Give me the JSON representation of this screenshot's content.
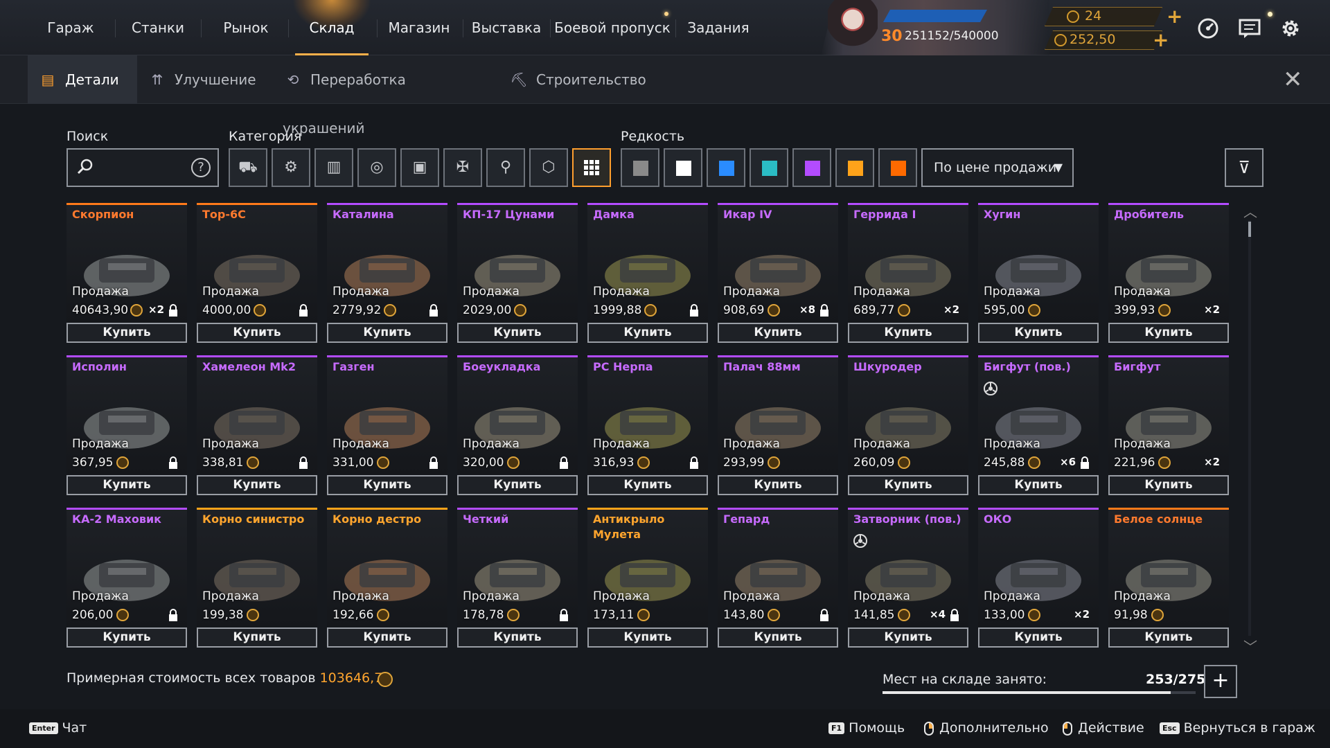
{
  "nav": {
    "items": [
      "Гараж",
      "Станки",
      "Рынок",
      "Склад",
      "Магазин",
      "Выставка",
      "Боевой пропуск",
      "Задания"
    ],
    "active": "Склад"
  },
  "profile": {
    "level": "30",
    "xp": "251152/540000",
    "currency_1": "24",
    "currency_2": "252,50",
    "xp_progress": 0.465
  },
  "subtabs": {
    "items": [
      {
        "label": "Детали",
        "icon": "parts-icon"
      },
      {
        "label": "Улучшение",
        "icon": "upgrade-icon"
      },
      {
        "label": "Переработка украшений",
        "icon": "recycle-icon"
      },
      {
        "label": "Строительство",
        "icon": "build-icon"
      }
    ],
    "active": "Детали"
  },
  "filters": {
    "search_label": "Поиск",
    "search_value": "",
    "category_label": "Категория",
    "rarity_label": "Редкость",
    "sort_value": "По цене продажи",
    "categories": [
      "cabin-icon",
      "weapon-icon",
      "module-icon",
      "wheel-icon",
      "frame-icon",
      "decor-icon",
      "paint-icon",
      "hardware-icon",
      "all-icon"
    ],
    "active_category": "all-icon",
    "rarities": [
      "#8a8a8a",
      "#ffffff",
      "#2a8cff",
      "#2bbcc4",
      "#b34cff",
      "#ffa31a",
      "#ff6a00"
    ]
  },
  "labels": {
    "sell": "Продажа",
    "buy": "Купить"
  },
  "items": [
    {
      "name": "Скорпион",
      "rarity": "orange",
      "price": "40643,90",
      "mult": "×2",
      "locked": true
    },
    {
      "name": "Тор-6С",
      "rarity": "orange",
      "price": "4000,00",
      "mult": "",
      "locked": true
    },
    {
      "name": "Каталина",
      "rarity": "epic",
      "price": "2779,92",
      "mult": "",
      "locked": true
    },
    {
      "name": "КП-17 Цунами",
      "rarity": "epic",
      "price": "2029,00",
      "mult": "",
      "locked": false
    },
    {
      "name": "Дамка",
      "rarity": "epic",
      "price": "1999,88",
      "mult": "",
      "locked": true
    },
    {
      "name": "Икар IV",
      "rarity": "epic",
      "price": "908,69",
      "mult": "×8",
      "locked": true
    },
    {
      "name": "Геррида I",
      "rarity": "epic",
      "price": "689,77",
      "mult": "×2",
      "locked": false
    },
    {
      "name": "Хугин",
      "rarity": "epic",
      "price": "595,00",
      "mult": "",
      "locked": false
    },
    {
      "name": "Дробитель",
      "rarity": "epic",
      "price": "399,93",
      "mult": "×2",
      "locked": false
    },
    {
      "name": "Исполин",
      "rarity": "epic",
      "price": "367,95",
      "mult": "",
      "locked": true
    },
    {
      "name": "Хамелеон Mk2",
      "rarity": "epic",
      "price": "338,81",
      "mult": "",
      "locked": true
    },
    {
      "name": "Газген",
      "rarity": "epic",
      "price": "331,00",
      "mult": "",
      "locked": true
    },
    {
      "name": "Боеукладка",
      "rarity": "epic",
      "price": "320,00",
      "mult": "",
      "locked": true
    },
    {
      "name": "РС Нерпа",
      "rarity": "epic",
      "price": "316,93",
      "mult": "",
      "locked": true
    },
    {
      "name": "Палач 88мм",
      "rarity": "epic",
      "price": "293,99",
      "mult": "",
      "locked": false
    },
    {
      "name": "Шкуродер",
      "rarity": "epic",
      "price": "260,09",
      "mult": "",
      "locked": false
    },
    {
      "name": "Бигфут (пов.)",
      "rarity": "epic",
      "price": "245,88",
      "mult": "×6",
      "locked": true
    },
    {
      "name": "Бигфут",
      "rarity": "epic",
      "price": "221,96",
      "mult": "×2",
      "locked": false
    },
    {
      "name": "КА-2 Маховик",
      "rarity": "epic",
      "price": "206,00",
      "mult": "",
      "locked": true
    },
    {
      "name": "Корно синистро",
      "rarity": "gold",
      "price": "199,38",
      "mult": "",
      "locked": false
    },
    {
      "name": "Корно дестро",
      "rarity": "gold",
      "price": "192,66",
      "mult": "",
      "locked": false
    },
    {
      "name": "Четкий",
      "rarity": "epic",
      "price": "178,78",
      "mult": "",
      "locked": true
    },
    {
      "name": "Антикрыло Мулета",
      "rarity": "gold",
      "price": "173,11",
      "mult": "",
      "locked": false
    },
    {
      "name": "Гепард",
      "rarity": "epic",
      "price": "143,80",
      "mult": "",
      "locked": true
    },
    {
      "name": "Затворник (пов.)",
      "rarity": "epic",
      "price": "141,85",
      "mult": "×4",
      "locked": true
    },
    {
      "name": "ОКО",
      "rarity": "epic",
      "price": "133,00",
      "mult": "×2",
      "locked": false
    },
    {
      "name": "Белое солнце",
      "rarity": "orange",
      "price": "91,98",
      "mult": "",
      "locked": false
    }
  ],
  "summary": {
    "total_label": "Примерная стоимость всех товаров",
    "total_value": "103646,73",
    "capacity_label": "Мест на складе занято:",
    "capacity_value": "253/275",
    "capacity_fraction": 0.92
  },
  "bottom": {
    "chat_key": "Enter",
    "chat": "Чат",
    "help_key": "F1",
    "help": "Помощь",
    "more": "Дополнительно",
    "action": "Действие",
    "back_key": "Esc",
    "back": "Вернуться в гараж"
  }
}
